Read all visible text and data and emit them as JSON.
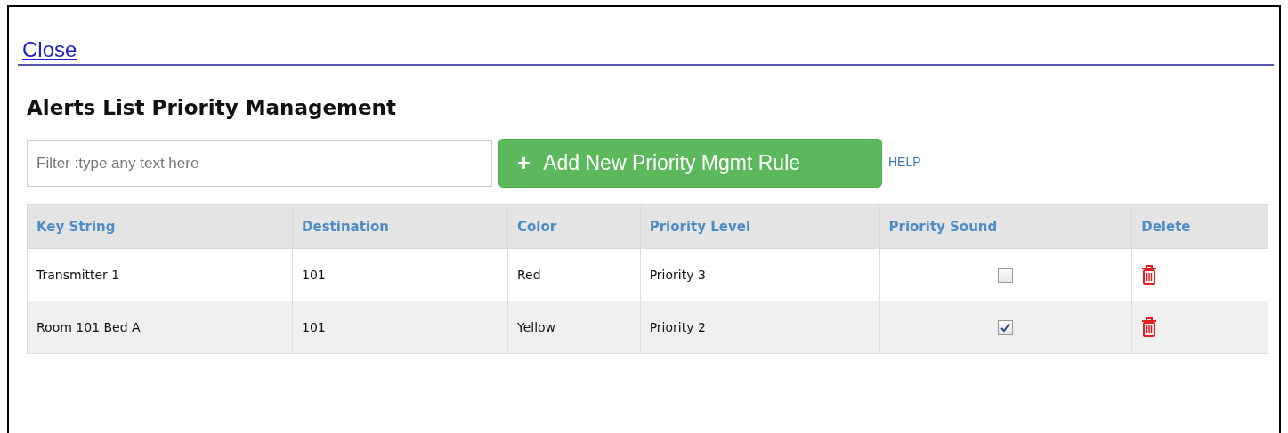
{
  "close_link": "Close",
  "title": "Alerts List Priority Management",
  "filter": {
    "placeholder": "Filter :type any text here"
  },
  "add_button": {
    "icon": "+",
    "label": "Add New Priority Mgmt Rule"
  },
  "help_link": "HELP",
  "table": {
    "columns": [
      "Key String",
      "Destination",
      "Color",
      "Priority Level",
      "Priority Sound",
      "Delete"
    ],
    "rows": [
      {
        "key_string": "Transmitter 1",
        "destination": "101",
        "color_name": "Red",
        "priority_level": "Priority 3",
        "priority_sound": false
      },
      {
        "key_string": "Room 101 Bed A",
        "destination": "101",
        "color_name": "Yellow",
        "priority_level": "Priority 2",
        "priority_sound": true
      }
    ]
  }
}
